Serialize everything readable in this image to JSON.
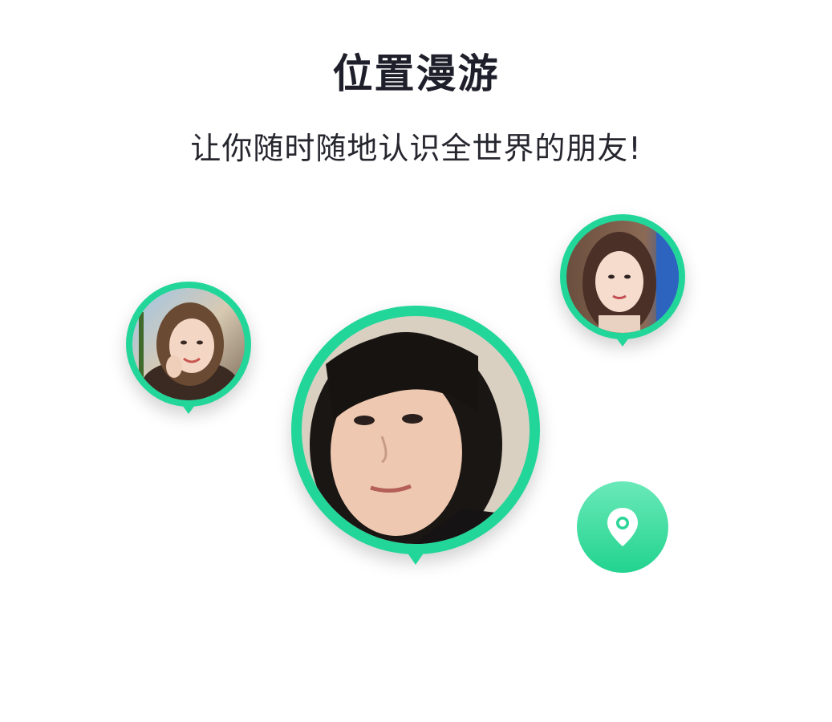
{
  "header": {
    "title": "位置漫游",
    "subtitle": "让你随时随地认识全世界的朋友!"
  },
  "avatars": {
    "left": {
      "label": "user-avatar-left"
    },
    "right": {
      "label": "user-avatar-right"
    },
    "center": {
      "label": "user-avatar-center"
    }
  },
  "actions": {
    "location_icon": "map-pin-icon"
  },
  "colors": {
    "accent": "#22d69a",
    "title_text": "#1f1f2b",
    "button_top": "#6ae9b9",
    "button_bottom": "#22d38e"
  }
}
